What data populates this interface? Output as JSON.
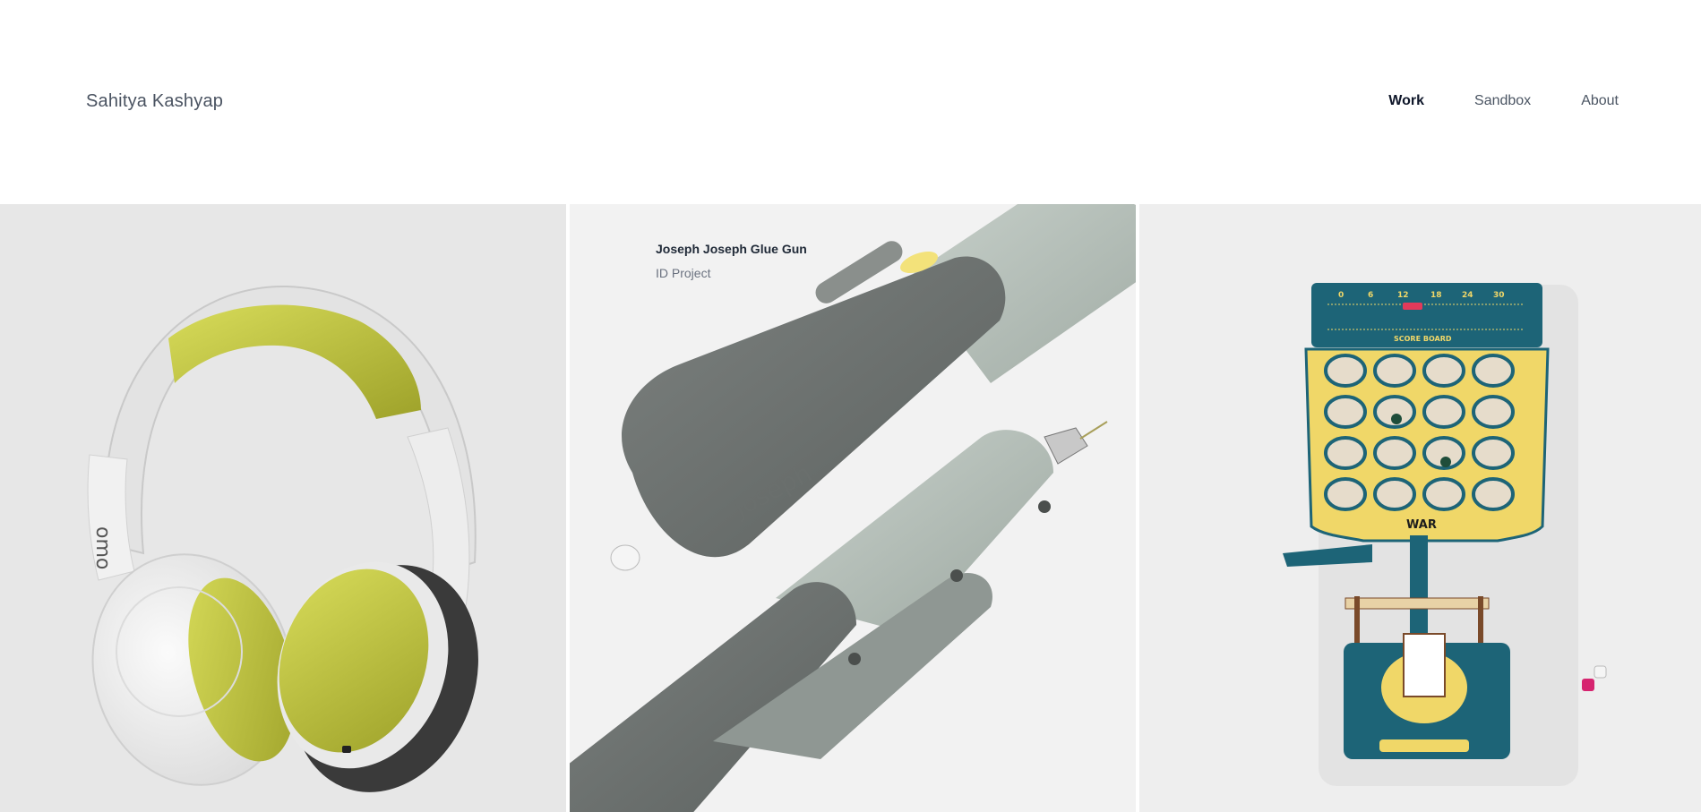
{
  "header": {
    "brand": "Sahitya Kashyap",
    "nav": [
      {
        "label": "Work",
        "active": true
      },
      {
        "label": "Sandbox",
        "active": false
      },
      {
        "label": "About",
        "active": false
      }
    ]
  },
  "projects": [
    {
      "title": "",
      "subtitle": "",
      "image_label": "omo"
    },
    {
      "title": "Joseph Joseph Glue Gun",
      "subtitle": "ID Project",
      "image_label": "Joseph"
    },
    {
      "title": "",
      "subtitle": "",
      "image_label": "WAR",
      "score_label": "SCORE BOARD",
      "score_ticks": [
        "0",
        "6",
        "12",
        "18",
        "24",
        "30"
      ]
    }
  ],
  "colors": {
    "nav_active": "#0f172a",
    "nav_inactive": "#4b5563",
    "brand": "#4a5361",
    "accent_lime": "#c9cf3a",
    "board_teal": "#1d6477",
    "board_yellow": "#f0d768"
  }
}
